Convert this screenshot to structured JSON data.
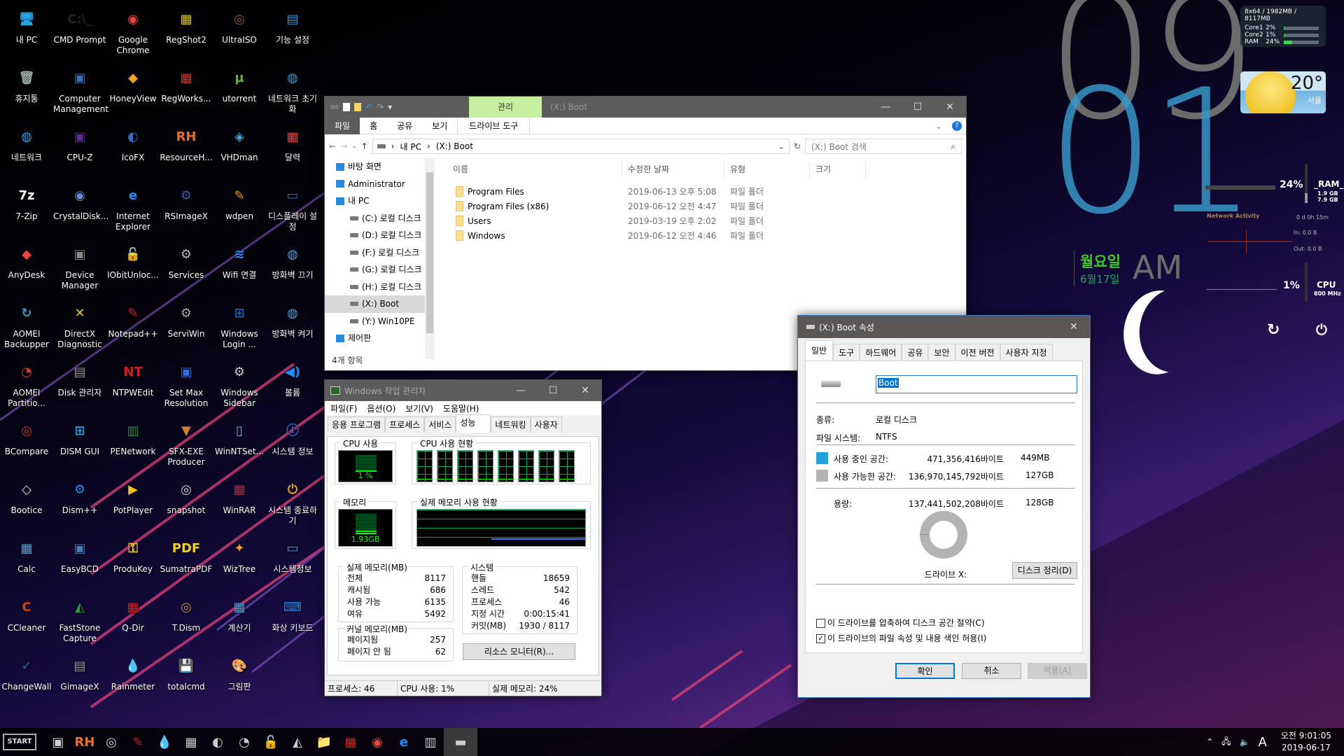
{
  "desktop": {
    "icons": [
      {
        "label": "내 PC",
        "glyph": "🖥",
        "color": "#2aa3e6"
      },
      {
        "label": "CMD Prompt",
        "glyph": "C:\\_",
        "color": "#222"
      },
      {
        "label": "Google Chrome",
        "glyph": "◉",
        "color": "#e8453c"
      },
      {
        "label": "RegShot2",
        "glyph": "▦",
        "color": "#d9c81a"
      },
      {
        "label": "UltraISO",
        "glyph": "◎",
        "color": "#8b5a3c"
      },
      {
        "label": "기능 설정",
        "glyph": "▤",
        "color": "#3a8fd9"
      },
      {
        "label": "휴지통",
        "glyph": "🗑",
        "color": "#9aa"
      },
      {
        "label": "Computer Management",
        "glyph": "▣",
        "color": "#3b6fb6"
      },
      {
        "label": "HoneyView",
        "glyph": "◆",
        "color": "#f0a030"
      },
      {
        "label": "RegWorks...",
        "glyph": "▦",
        "color": "#c0392b"
      },
      {
        "label": "utorrent",
        "glyph": "µ",
        "color": "#5cb132"
      },
      {
        "label": "네트워크 초기화",
        "glyph": "◍",
        "color": "#3a9ad9"
      },
      {
        "label": "네트워크",
        "glyph": "◍",
        "color": "#2aa3e6"
      },
      {
        "label": "CPU-Z",
        "glyph": "▣",
        "color": "#5b2d90"
      },
      {
        "label": "IcoFX",
        "glyph": "◐",
        "color": "#2e6ec9"
      },
      {
        "label": "ResourceH...",
        "glyph": "RH",
        "color": "#e8702a"
      },
      {
        "label": "VHDman",
        "glyph": "◈",
        "color": "#4aa0d9"
      },
      {
        "label": "달력",
        "glyph": "▦",
        "color": "#e04040"
      },
      {
        "label": "7-Zip",
        "glyph": "7z",
        "color": "#fff"
      },
      {
        "label": "CrystalDisk...",
        "glyph": "◉",
        "color": "#6b8cc9"
      },
      {
        "label": "Internet Explorer",
        "glyph": "e",
        "color": "#1e90ff"
      },
      {
        "label": "RSImageX",
        "glyph": "⚙",
        "color": "#4060a0"
      },
      {
        "label": "wdpen",
        "glyph": "✎",
        "color": "#e8a030"
      },
      {
        "label": "디스플레이 설정",
        "glyph": "▭",
        "color": "#2a6fb6"
      },
      {
        "label": "AnyDesk",
        "glyph": "◆",
        "color": "#ef443b"
      },
      {
        "label": "Device Manager",
        "glyph": "▣",
        "color": "#888"
      },
      {
        "label": "IObitUnloc...",
        "glyph": "🔓",
        "color": "#b08030"
      },
      {
        "label": "Services",
        "glyph": "⚙",
        "color": "#bbb"
      },
      {
        "label": "Wifi 연결",
        "glyph": "≋",
        "color": "#1e90ff"
      },
      {
        "label": "방화벽 끄기",
        "glyph": "◍",
        "color": "#4aa0d9"
      },
      {
        "label": "AOMEI Backupper",
        "glyph": "↻",
        "color": "#2a9fd0"
      },
      {
        "label": "DirectX Diagnostic",
        "glyph": "✕",
        "color": "#e8d020"
      },
      {
        "label": "Notepad++",
        "glyph": "✎",
        "color": "#c0203a"
      },
      {
        "label": "ServiWin",
        "glyph": "⚙",
        "color": "#aaa"
      },
      {
        "label": "Windows Login ...",
        "glyph": "⊞",
        "color": "#1e5eb0"
      },
      {
        "label": "방화벽 켜기",
        "glyph": "◍",
        "color": "#4aa0d9"
      },
      {
        "label": "AOMEI Partitio...",
        "glyph": "◔",
        "color": "#d03a3a"
      },
      {
        "label": "Disk 관리자",
        "glyph": "▤",
        "color": "#999"
      },
      {
        "label": "NTPWEdit",
        "glyph": "NT",
        "color": "#d02020"
      },
      {
        "label": "Set Max Resolution",
        "glyph": "▣",
        "color": "#2a6fd9"
      },
      {
        "label": "Windows Sidebar",
        "glyph": "⚙",
        "color": "#ccc"
      },
      {
        "label": "볼륨",
        "glyph": "◀)",
        "color": "#1e90ff"
      },
      {
        "label": "BCompare",
        "glyph": "◎",
        "color": "#c03030"
      },
      {
        "label": "DISM GUI",
        "glyph": "⊞",
        "color": "#2a9fd9"
      },
      {
        "label": "PENetwork",
        "glyph": "▥",
        "color": "#2a8f4a"
      },
      {
        "label": "SFX-EXE Producer",
        "glyph": "▼",
        "color": "#d08030"
      },
      {
        "label": "WinNTSet...",
        "glyph": "▯",
        "color": "#7ab0d0"
      },
      {
        "label": "시스템 정보",
        "glyph": "ⓘ",
        "color": "#2a6fd9"
      },
      {
        "label": "Bootice",
        "glyph": "◇",
        "color": "#ddd"
      },
      {
        "label": "Dism++",
        "glyph": "⚙",
        "color": "#1e90ff"
      },
      {
        "label": "PotPlayer",
        "glyph": "▶",
        "color": "#f0c020"
      },
      {
        "label": "snapshot",
        "glyph": "◎",
        "color": "#ddd"
      },
      {
        "label": "WinRAR",
        "glyph": "▦",
        "color": "#a03050"
      },
      {
        "label": "시스템 종료하기",
        "glyph": "⏻",
        "color": "#f0a020"
      },
      {
        "label": "Calc",
        "glyph": "▦",
        "color": "#5aa0d9"
      },
      {
        "label": "EasyBCD",
        "glyph": "▣",
        "color": "#4a7ab9"
      },
      {
        "label": "ProduKey",
        "glyph": "⚿",
        "color": "#e8c030"
      },
      {
        "label": "SumatraPDF",
        "glyph": "PDF",
        "color": "#f0d020"
      },
      {
        "label": "WizTree",
        "glyph": "✦",
        "color": "#f0a040"
      },
      {
        "label": "시스템정보",
        "glyph": "▭",
        "color": "#3aa0e0"
      },
      {
        "label": "CCleaner",
        "glyph": "C",
        "color": "#d04020"
      },
      {
        "label": "FastStone Capture",
        "glyph": "◭",
        "color": "#2a9f3a"
      },
      {
        "label": "Q-Dir",
        "glyph": "▦",
        "color": "#d02020"
      },
      {
        "label": "T.Dism",
        "glyph": "◎",
        "color": "#c09050"
      },
      {
        "label": "계산기",
        "glyph": "▦",
        "color": "#5aa0d9"
      },
      {
        "label": "화상 키보드",
        "glyph": "⌨",
        "color": "#3a80d0"
      },
      {
        "label": "ChangeWall",
        "glyph": "✓",
        "color": "#2a60c0"
      },
      {
        "label": "GimageX",
        "glyph": "▤",
        "color": "#999"
      },
      {
        "label": "Rainmeter",
        "glyph": "💧",
        "color": "#aab"
      },
      {
        "label": "totalcmd",
        "glyph": "💾",
        "color": "#3060c0"
      },
      {
        "label": "그림판",
        "glyph": "🎨",
        "color": "#e0a040"
      }
    ]
  },
  "explorer": {
    "title": "(X:) Boot",
    "context_tab": "관리",
    "ribbon_tabs": [
      "파일",
      "홈",
      "공유",
      "보기",
      "드라이브 도구"
    ],
    "breadcrumb": [
      "내 PC",
      "(X:) Boot"
    ],
    "search_placeholder": "(X:) Boot 검색",
    "nav": [
      {
        "label": "바탕 화면",
        "level": 0
      },
      {
        "label": "Administrator",
        "level": 0
      },
      {
        "label": "내 PC",
        "level": 0
      },
      {
        "label": "(C:) 로컬 디스크",
        "level": 1
      },
      {
        "label": "(D:) 로컬 디스크",
        "level": 1
      },
      {
        "label": "(F:) 로컬 디스크",
        "level": 1
      },
      {
        "label": "(G:) 로컬 디스크",
        "level": 1
      },
      {
        "label": "(H:) 로컬 디스크",
        "level": 1
      },
      {
        "label": "(X:) Boot",
        "level": 1,
        "selected": true
      },
      {
        "label": "(Y:) Win10PE",
        "level": 1
      },
      {
        "label": "제어판",
        "level": 0
      }
    ],
    "columns": [
      "이름",
      "수정한 날짜",
      "유형",
      "크기"
    ],
    "files": [
      {
        "name": "Program Files",
        "date": "2019-06-13 오후 5:08",
        "type": "파일 폴더"
      },
      {
        "name": "Program Files (x86)",
        "date": "2019-06-12 오전 4:47",
        "type": "파일 폴더"
      },
      {
        "name": "Users",
        "date": "2019-03-19 오후 2:02",
        "type": "파일 폴더"
      },
      {
        "name": "Windows",
        "date": "2019-06-12 오전 4:46",
        "type": "파일 폴더"
      }
    ],
    "status": "4개 항목"
  },
  "taskmgr": {
    "title": "Windows 작업 관리자",
    "menu": [
      "파일(F)",
      "옵션(O)",
      "보기(V)",
      "도움말(H)"
    ],
    "tabs": [
      "응용 프로그램",
      "프로세스",
      "서비스",
      "성능",
      "네트워킹",
      "사용자"
    ],
    "active_tab": "성능",
    "cpu_label": "CPU 사용",
    "cpu_value": "1 %",
    "cpu_history_label": "CPU 사용 현황",
    "mem_label": "메모리",
    "mem_value": "1.93GB",
    "mem_history_label": "실제 메모리 사용 현황",
    "physical": {
      "title": "실제 메모리(MB)",
      "rows": [
        [
          "전체",
          "8117"
        ],
        [
          "캐시됨",
          "686"
        ],
        [
          "사용 가능",
          "6135"
        ],
        [
          "여유",
          "5492"
        ]
      ]
    },
    "kernel": {
      "title": "커널 메모리(MB)",
      "rows": [
        [
          "페이지됨",
          "257"
        ],
        [
          "페이지 안 됨",
          "62"
        ]
      ]
    },
    "system": {
      "title": "시스템",
      "rows": [
        [
          "핸들",
          "18659"
        ],
        [
          "스레드",
          "542"
        ],
        [
          "프로세스",
          "46"
        ],
        [
          "지정 시간",
          "0:00:15:41"
        ],
        [
          "커밋(MB)",
          "1930 / 8117"
        ]
      ]
    },
    "resource_btn": "리소스 모니터(R)...",
    "statusbar": [
      "프로세스: 46",
      "CPU 사용: 1%",
      "실제 메모리: 24%"
    ]
  },
  "props": {
    "title": "(X:) Boot 속성",
    "tabs": [
      "일반",
      "도구",
      "하드웨어",
      "공유",
      "보안",
      "이전 버전",
      "사용자 지정"
    ],
    "name_value": "Boot",
    "type_label": "종류:",
    "type_value": "로컬 디스크",
    "fs_label": "파일 시스템:",
    "fs_value": "NTFS",
    "used_label": "사용 중인 공간:",
    "used_bytes": "471,356,416바이트",
    "used_size": "449MB",
    "free_label": "사용 가능한 공간:",
    "free_bytes": "136,970,145,792바이트",
    "free_size": "127GB",
    "cap_label": "용량:",
    "cap_bytes": "137,441,502,208바이트",
    "cap_size": "128GB",
    "used_color": "#26a0da",
    "free_color": "#b3b3b3",
    "used_fraction": 0.0034,
    "drive_label": "드라이브 X:",
    "cleanup_btn": "디스크 정리(D)",
    "compress_label": "이 드라이브를 압축하여 디스크 공간 절약(C)",
    "compress_checked": false,
    "index_label": "이 드라이브의 파일 속성 및 내용 색인 허용(I)",
    "index_checked": true,
    "ok": "확인",
    "cancel": "취소",
    "apply": "적용(A)"
  },
  "widgets": {
    "hour": "09",
    "minute": "01",
    "weekday": "월요일",
    "date": "6월17일",
    "ampm": "AM",
    "sysmon_header": "8x64 / 1982MB / 8117MB",
    "sysmon": [
      {
        "label": "Core1",
        "value": "2%",
        "fraction": 0.02
      },
      {
        "label": "Core2",
        "value": "1%",
        "fraction": 0.01
      },
      {
        "label": "RAM",
        "value": "24%",
        "fraction": 0.24
      }
    ],
    "weather_temp": "20°",
    "weather_city": "서울",
    "ram_pct": "24%",
    "ram_title": "_RAM_",
    "ram_used": "1.9 GB",
    "ram_total": "7.9 GB",
    "net_title": "Network Activity",
    "uptime": "0 d 0h 15m",
    "net_in": "In: 0.0 B",
    "net_out": "Out: 0.0 B",
    "cpu_pct": "1%",
    "cpu_title": "CPU",
    "cpu_freq": "800 MHz"
  },
  "taskbar": {
    "start": "START",
    "apps": [
      "computer-management",
      "resourcehacker",
      "bcompare",
      "notepadpp",
      "rainmeter",
      "calc",
      "icofx",
      "aomei-partition",
      "iobit-unlocker",
      "faststone",
      "file-explorer",
      "q-dir",
      "chrome",
      "internet-explorer",
      "task-manager",
      "drive-properties"
    ],
    "tray_ime": "A",
    "time": "오전 9:01:05",
    "date": "2019-06-17"
  }
}
